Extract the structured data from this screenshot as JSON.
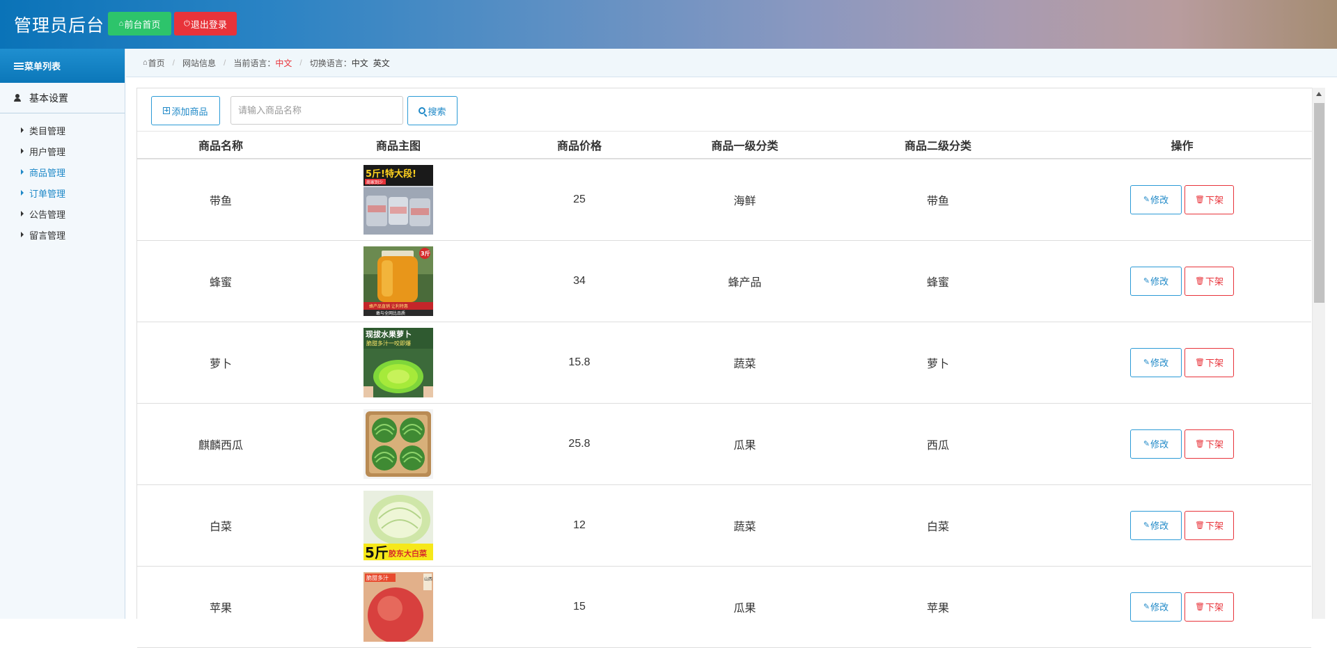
{
  "header": {
    "title": "管理员后台",
    "home_label": "前台首页",
    "logout_label": "退出登录"
  },
  "sidebar": {
    "menu_title": "菜单列表",
    "group_label": "基本设置",
    "items": [
      {
        "label": "类目管理",
        "active": false
      },
      {
        "label": "用户管理",
        "active": false
      },
      {
        "label": "商品管理",
        "active": true
      },
      {
        "label": "订单管理",
        "active": true
      },
      {
        "label": "公告管理",
        "active": false
      },
      {
        "label": "留言管理",
        "active": false
      }
    ]
  },
  "breadcrumb": {
    "home": "首页",
    "site_info": "网站信息",
    "current_lang_label": "当前语言：",
    "current_lang": "中文",
    "switch_lang_label": "切换语言：",
    "lang_zh": "中文",
    "lang_en": "英文"
  },
  "toolbar": {
    "add_label": "添加商品",
    "search_placeholder": "请输入商品名称",
    "search_value": "",
    "search_label": "搜索"
  },
  "table": {
    "columns": [
      "商品名称",
      "商品主图",
      "商品价格",
      "商品一级分类",
      "商品二级分类",
      "操作"
    ],
    "edit_label": "修改",
    "off_label": "下架",
    "rows": [
      {
        "name": "带鱼",
        "price": "25",
        "cat1": "海鲜",
        "cat2": "带鱼",
        "image": "hairtail"
      },
      {
        "name": "蜂蜜",
        "price": "34",
        "cat1": "蜂产品",
        "cat2": "蜂蜜",
        "image": "honey"
      },
      {
        "name": "萝卜",
        "price": "15.8",
        "cat1": "蔬菜",
        "cat2": "萝卜",
        "image": "radish"
      },
      {
        "name": "麒麟西瓜",
        "price": "25.8",
        "cat1": "瓜果",
        "cat2": "西瓜",
        "image": "watermelon"
      },
      {
        "name": "白菜",
        "price": "12",
        "cat1": "蔬菜",
        "cat2": "白菜",
        "image": "cabbage"
      },
      {
        "name": "苹果",
        "price": "15",
        "cat1": "瓜果",
        "cat2": "苹果",
        "image": "apple"
      }
    ],
    "image_texts": {
      "hairtail": "5斤!特大段!",
      "hairtail_tag": "商家到少",
      "honey_badge": "3斤",
      "honey_line1": "蜂产品直销 让利特惠",
      "honey_line2": "敢与全网比品质",
      "radish_line1": "现拔水果萝卜",
      "radish_line2": "脆甜多汁一咬即爆",
      "cabbage_big": "5斤",
      "cabbage_rest": "胶东大白菜",
      "apple_line": "脆甜多汁",
      "apple_side": "山西"
    }
  }
}
